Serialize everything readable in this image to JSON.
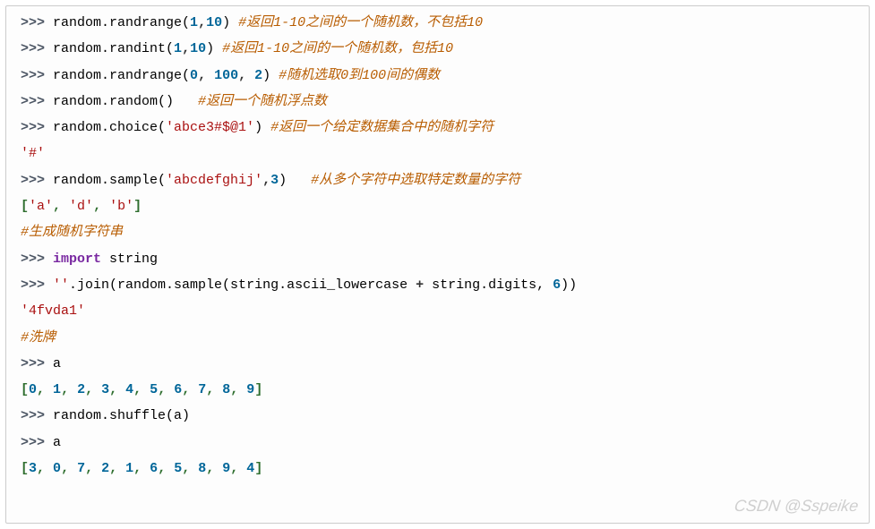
{
  "prompt": ">>> ",
  "lines": {
    "l1": {
      "code": "random.randrange(",
      "a1": "1",
      "c1": ",",
      "a2": "10",
      "end": ") ",
      "comment": "#返回1-10之间的一个随机数，不包括10"
    },
    "l2": {
      "code": "random.randint(",
      "a1": "1",
      "c1": ",",
      "a2": "10",
      "end": ") ",
      "comment": "#返回1-10之间的一个随机数，包括10"
    },
    "l3": {
      "code": "random.randrange(",
      "a1": "0",
      "c1": ", ",
      "a2": "100",
      "c2": ", ",
      "a3": "2",
      "end": ") ",
      "comment": "#随机选取0到100间的偶数"
    },
    "l4": {
      "code": "random.random()   ",
      "comment": "#返回一个随机浮点数"
    },
    "l5": {
      "code": "random.choice(",
      "s": "'abce3#$@1'",
      "end": ") ",
      "comment": "#返回一个给定数据集合中的随机字符"
    },
    "l6": {
      "out": "'#'"
    },
    "l7": {
      "code": "random.sample(",
      "s": "'abcdefghij'",
      "c1": ",",
      "a1": "3",
      "end": ")   ",
      "comment": "#从多个字符中选取特定数量的字符"
    },
    "l8": {
      "out_open": "[",
      "s1": "'a'",
      "c1": ", ",
      "s2": "'d'",
      "c2": ", ",
      "s3": "'b'",
      "out_close": "]"
    },
    "l9": {
      "comment": "#生成随机字符串"
    },
    "l10": {
      "kw": "import",
      "rest": " string"
    },
    "l11": {
      "s1": "''",
      "p1": ".join(random.sample(string.ascii_lowercase ",
      "op": "+",
      "p2": " string.digits, ",
      "n": "6",
      "end": "))"
    },
    "l12": {
      "out": "'4fvda1'"
    },
    "l13": {
      "comment": "#洗牌"
    },
    "l14": {
      "code": "a"
    },
    "l15": {
      "out": "[",
      "nums": [
        "0",
        "1",
        "2",
        "3",
        "4",
        "5",
        "6",
        "7",
        "8",
        "9"
      ],
      "close": "]"
    },
    "l16": {
      "code": "random.shuffle(a)"
    },
    "l17": {
      "code": "a"
    },
    "l18": {
      "out": "[",
      "nums": [
        "3",
        "0",
        "7",
        "2",
        "1",
        "6",
        "5",
        "8",
        "9",
        "4"
      ],
      "close": "]"
    }
  },
  "watermark": "CSDN @Sspeike"
}
